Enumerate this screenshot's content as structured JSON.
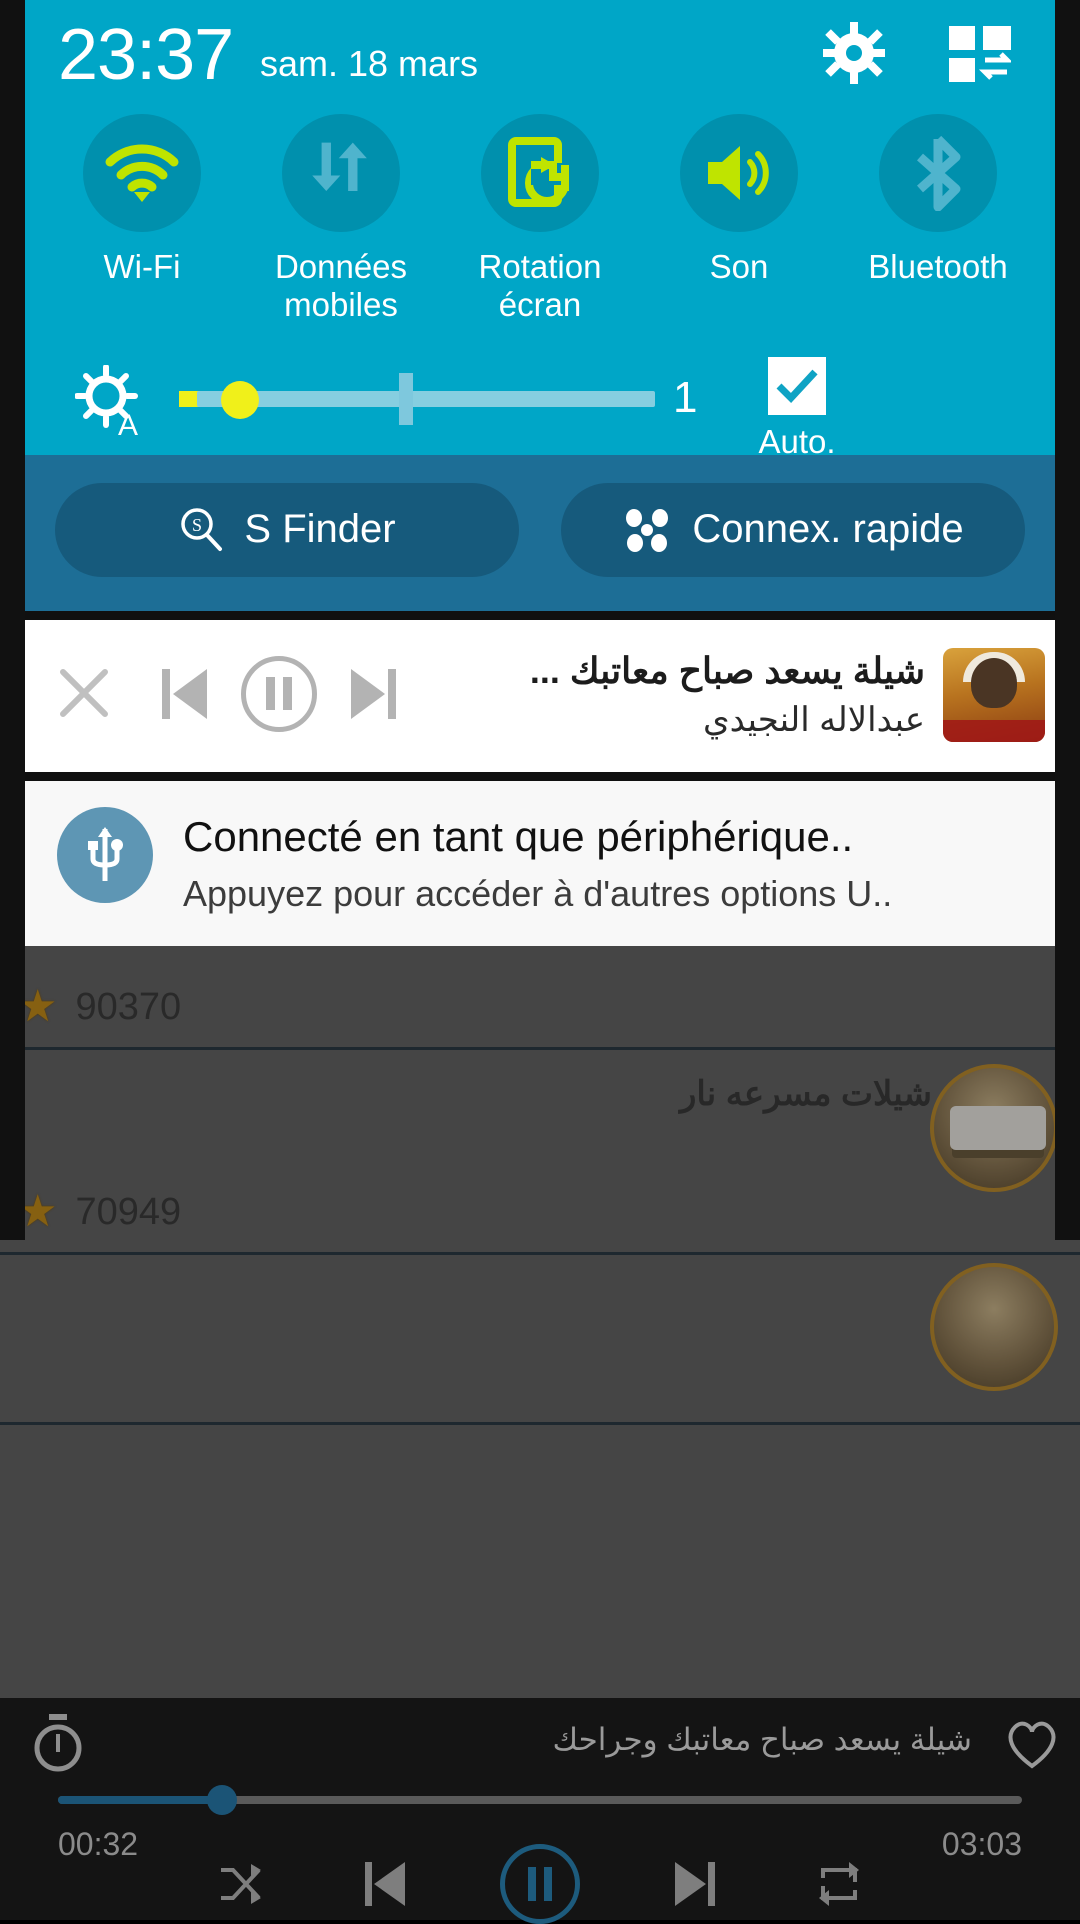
{
  "status_bar": {
    "clock": "23:37",
    "date": "sam. 18 mars",
    "gear_icon": "gear-icon",
    "edit_icon": "quick-settings-edit-icon"
  },
  "quick_settings": {
    "toggles": [
      {
        "label": "Wi-Fi",
        "icon": "wifi-icon",
        "active": true
      },
      {
        "label": "Données mobiles",
        "icon": "mobile-data-icon",
        "active": false
      },
      {
        "label": "Rotation écran",
        "icon": "screen-rotation-icon",
        "active": true
      },
      {
        "label": "Son",
        "icon": "sound-icon",
        "active": true
      },
      {
        "label": "Bluetooth",
        "icon": "bluetooth-icon",
        "active": false
      }
    ],
    "brightness": {
      "icon": "brightness-auto-icon",
      "value": "1",
      "auto_label": "Auto.",
      "auto_checked": true,
      "percent": 4
    },
    "shortcuts": [
      {
        "label": "S Finder",
        "icon": "s-finder-icon"
      },
      {
        "label": "Connex. rapide",
        "icon": "quick-connect-icon"
      }
    ],
    "colors": {
      "panel": "#00a6c7",
      "circle": "#0090ad",
      "accent_active": "#bfe400",
      "accent_inactive": "#4fb4cd",
      "finder_bar": "#1d6e96",
      "finder_button": "#165a7c",
      "slider_thumb": "#f0f01a"
    }
  },
  "notifications": [
    {
      "type": "music",
      "title": "شيلة يسعد صباح معاتبك ...",
      "artist": "عبدالاله النجيدي",
      "close_icon": "close-icon",
      "prev_icon": "previous-track-icon",
      "play_icon": "pause-icon",
      "next_icon": "next-track-icon",
      "album_art": "album-art-thumbnail"
    },
    {
      "type": "usb",
      "title": "Connecté en tant que périphérique..",
      "subtitle": "Appuyez pour accéder à d'autres options U..",
      "icon": "usb-icon",
      "icon_color": "#5e96b4"
    }
  ],
  "background_app": {
    "rows": [
      {
        "title": "",
        "count": "90370",
        "thumb": "square"
      },
      {
        "title": "شيلات مسرعه نار",
        "count": "70949",
        "thumb": "round"
      }
    ],
    "star_icon": "star-icon",
    "chevron_icon": "chevron-left-icon"
  },
  "bottom_player": {
    "track_title": "شيلة يسعد صباح معاتبك وجراحك",
    "timer_icon": "sleep-timer-icon",
    "favorite_icon": "heart-icon",
    "elapsed": "00:32",
    "duration": "03:03",
    "progress_percent": 17,
    "shuffle_icon": "shuffle-icon",
    "prev_icon": "previous-track-icon",
    "play_icon": "pause-icon",
    "next_icon": "next-track-icon",
    "repeat_icon": "repeat-icon",
    "accent_color": "#1d5b7d"
  }
}
